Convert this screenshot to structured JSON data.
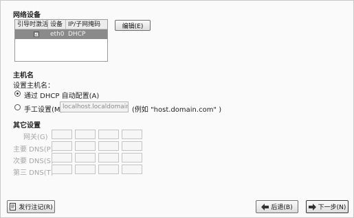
{
  "network": {
    "title": "网络设备",
    "columns": [
      "引导时激活",
      "设备",
      "IP/子网掩码"
    ],
    "devices": [
      {
        "active": "☑",
        "device": "eth0",
        "ip": "DHCP"
      }
    ],
    "edit_button": "编辑(E)"
  },
  "hostname": {
    "title": "主机名",
    "set_label": "设置主机名：",
    "option_dhcp": "通过 DHCP 自动配置(A)",
    "option_manual": "手工设置(M)",
    "manual_value": "localhost.localdomain",
    "example": "(例如 \"host.domain.com\" )"
  },
  "misc": {
    "title": "其它设置",
    "gateway_label": "网关(G)",
    "dns1_label": "主要 DNS(P)",
    "dns2_label": "次要 DNS(S)",
    "dns3_label": "第三 DNS(T)"
  },
  "footer": {
    "release_notes": "发行注记(R)",
    "back": "后退(B)",
    "next": "下一步(N)"
  }
}
